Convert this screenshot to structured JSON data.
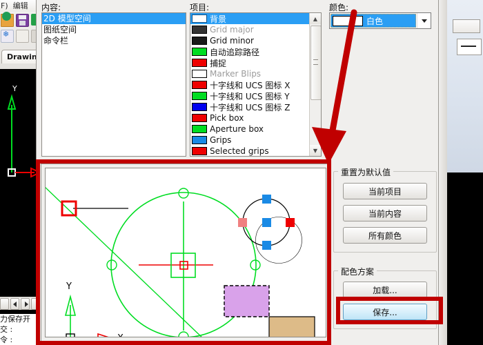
{
  "background_app": {
    "menu_items": [
      "F)",
      "编辑"
    ],
    "tab_label": "Drawing",
    "command_lines": [
      "力保存开",
      "交 :",
      "令 :"
    ],
    "toolbar_icons": [
      "open-icon",
      "save-icon",
      "redo-icon",
      "snowflake-icon",
      "print-preview-icon"
    ]
  },
  "dialog": {
    "contents": {
      "label": "内容:",
      "items": [
        {
          "text": "2D 模型空间",
          "selected": true
        },
        {
          "text": "图纸空间",
          "selected": false
        },
        {
          "text": "命令栏",
          "selected": false
        }
      ]
    },
    "items_panel": {
      "label": "项目:",
      "rows": [
        {
          "text": "背景",
          "color": "#ffffff",
          "selected": true,
          "dim": false
        },
        {
          "text": "Grid major",
          "color": "#333333",
          "selected": false,
          "dim": true
        },
        {
          "text": "Grid minor",
          "color": "#1a1a1a",
          "selected": false,
          "dim": false
        },
        {
          "text": "自动追踪路径",
          "color": "#00dd22",
          "selected": false,
          "dim": false
        },
        {
          "text": "捕捉",
          "color": "#ee0000",
          "selected": false,
          "dim": false
        },
        {
          "text": "Marker Blips",
          "color": "#ffffff",
          "selected": false,
          "dim": true
        },
        {
          "text": "十字线和 UCS 图标 X",
          "color": "#ee0000",
          "selected": false,
          "dim": false
        },
        {
          "text": "十字线和 UCS 图标 Y",
          "color": "#00dd22",
          "selected": false,
          "dim": false
        },
        {
          "text": "十字线和 UCS 图标 Z",
          "color": "#0000ee",
          "selected": false,
          "dim": false
        },
        {
          "text": "Pick box",
          "color": "#ee0000",
          "selected": false,
          "dim": false
        },
        {
          "text": "Aperture box",
          "color": "#00dd22",
          "selected": false,
          "dim": false
        },
        {
          "text": "Grips",
          "color": "#1a8ae5",
          "selected": false,
          "dim": false
        },
        {
          "text": "Selected grips",
          "color": "#ee0000",
          "selected": false,
          "dim": false
        }
      ],
      "scroll_up_glyph": "▲",
      "scroll_down_glyph": "▼"
    },
    "color": {
      "label": "颜色:",
      "selected_value": "白色",
      "swatch_color": "#ffffff",
      "dropdown_glyph": "▼"
    },
    "reset_group": {
      "title": "重置为默认值",
      "buttons": [
        {
          "label": "当前项目"
        },
        {
          "label": "当前内容"
        },
        {
          "label": "所有颜色"
        }
      ]
    },
    "scheme_group": {
      "title": "配色方案",
      "buttons": [
        {
          "label": "加载...",
          "primary": false
        },
        {
          "label": "保存...",
          "primary": true,
          "highlighted": true
        }
      ]
    },
    "preview": {
      "name": "preview-pane",
      "highlighted": true,
      "axis_labels": {
        "y": "Y",
        "x": "X"
      },
      "colors": {
        "crosshair": "#ee0000",
        "autotrack": "#00dd22",
        "grips": "#1a8ae5",
        "selected_grips": "#ee0000",
        "hover_grips": "#f08080",
        "marker": "#d9a2ea",
        "panel": "#ddbb88"
      }
    }
  },
  "annotations": {
    "accent_color": "#c00000",
    "arrow_from": "color-swatch",
    "arrow_to": "preview-pane",
    "highlight_boxes": [
      "preview-pane",
      "save-button",
      "color-swatch"
    ]
  }
}
